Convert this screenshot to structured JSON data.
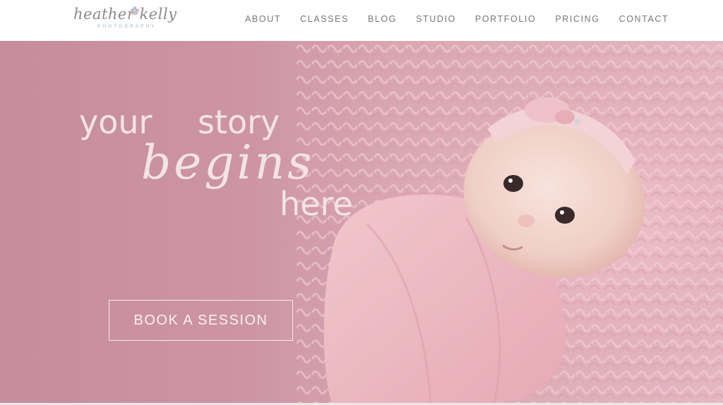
{
  "logo": {
    "script": "heather kelly",
    "sub": "PHOTOGRAPHY"
  },
  "nav": {
    "items": [
      {
        "label": "ABOUT"
      },
      {
        "label": "CLASSES"
      },
      {
        "label": "BLOG"
      },
      {
        "label": "STUDIO"
      },
      {
        "label": "PORTFOLIO"
      },
      {
        "label": "PRICING"
      },
      {
        "label": "CONTACT"
      }
    ]
  },
  "hero": {
    "line1a": "your",
    "line1b": "story",
    "line2": "begins",
    "line3": "here",
    "cta": "BOOK A SESSION"
  },
  "colors": {
    "hero_pink": "#c98f9f",
    "headline": "#f3e3e7",
    "nav_text": "#777777",
    "logo_accent": "#8fb7c9"
  }
}
